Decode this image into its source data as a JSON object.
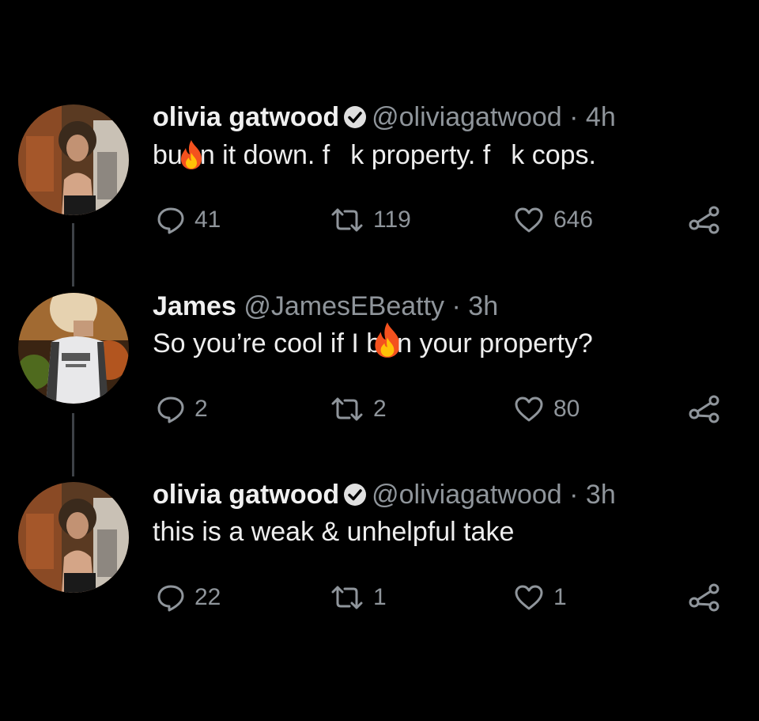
{
  "tweets": [
    {
      "name": "olivia gatwood",
      "verified": true,
      "handle": "@oliviagatwood",
      "separator": "·",
      "time": "4h",
      "text_parts": [
        "bu",
        "n it down. f",
        "k property. f",
        "k cops."
      ],
      "replies": "41",
      "retweets": "119",
      "likes": "646"
    },
    {
      "name": "James",
      "verified": false,
      "handle": "@JamesEBeatty",
      "separator": "·",
      "time": "3h",
      "text_parts": [
        "So you’re cool if I b",
        "n your property?"
      ],
      "replies": "2",
      "retweets": "2",
      "likes": "80"
    },
    {
      "name": "olivia gatwood",
      "verified": true,
      "handle": "@oliviagatwood",
      "separator": "·",
      "time": "3h",
      "text": "this is a weak & unhelpful take",
      "replies": "22",
      "retweets": "1",
      "likes": "1"
    }
  ],
  "icons": {
    "reply": "reply-icon",
    "retweet": "retweet-icon",
    "like": "heart-icon",
    "share": "share-icon",
    "verified": "verified-badge-icon",
    "emoji": "fire-emoji"
  },
  "colors": {
    "background": "#000000",
    "text": "#e7e9ea",
    "muted": "#8f959b",
    "thread_line": "#3d4146"
  }
}
